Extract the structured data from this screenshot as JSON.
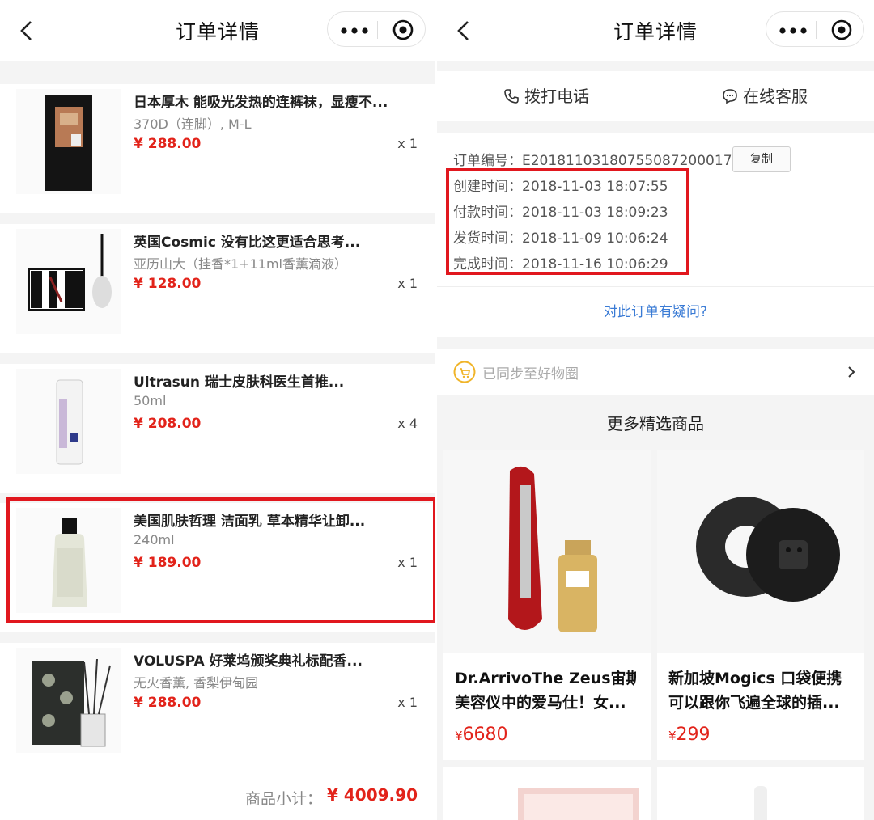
{
  "left": {
    "header": {
      "title": "订单详情"
    },
    "items": [
      {
        "name": "日本厚木 能吸光发热的连裤袜，显瘦不...",
        "spec": "370D（连脚）, M-L",
        "price": "¥ 288.00",
        "qty": "x 1"
      },
      {
        "name": "英国Cosmic 没有比这更适合思考...",
        "spec": "亚历山大（挂香*1+11ml香薰滴液）",
        "price": "¥ 128.00",
        "qty": "x 1"
      },
      {
        "name": "Ultrasun 瑞士皮肤科医生首推...",
        "spec": "50ml",
        "price": "¥ 208.00",
        "qty": "x 4"
      },
      {
        "name": "美国肌肤哲理 洁面乳 草本精华让卸...",
        "spec": "240ml",
        "price": "¥ 189.00",
        "qty": "x 1"
      },
      {
        "name": "VOLUSPA 好莱坞颁奖典礼标配香...",
        "spec": "无火香薰, 香梨伊甸园",
        "price": "¥ 288.00",
        "qty": "x 1"
      }
    ],
    "subtotal": {
      "label": "商品小计：",
      "value": "¥ 4009.90"
    }
  },
  "right": {
    "header": {
      "title": "订单详情"
    },
    "actions": {
      "call": "拨打电话",
      "service": "在线客服"
    },
    "order": {
      "number_label": "订单编号：",
      "number": "E20181103180755087200017",
      "copy": "复制",
      "created_label": "创建时间：",
      "created": "2018-11-03 18:07:55",
      "paid_label": "付款时间：",
      "paid": "2018-11-03 18:09:23",
      "shipped_label": "发货时间：",
      "shipped": "2018-11-09 10:06:24",
      "finished_label": "完成时间：",
      "finished": "2018-11-16 10:06:29"
    },
    "question": "对此订单有疑问?",
    "sync": "已同步至好物圈",
    "more_title": "更多精选商品",
    "recommend": [
      {
        "line1": "Dr.ArrivoThe Zeus宙斯",
        "line2": "美容仪中的爱马仕！女...",
        "currency": "¥",
        "price": "6680"
      },
      {
        "line1": "新加坡Mogics 口袋便携",
        "line2": "可以跟你飞遍全球的插...",
        "currency": "¥",
        "price": "299"
      }
    ]
  },
  "colors": {
    "price_red": "#e2231a",
    "highlight_red": "#e1171e",
    "link_blue": "#3a7bd5"
  }
}
